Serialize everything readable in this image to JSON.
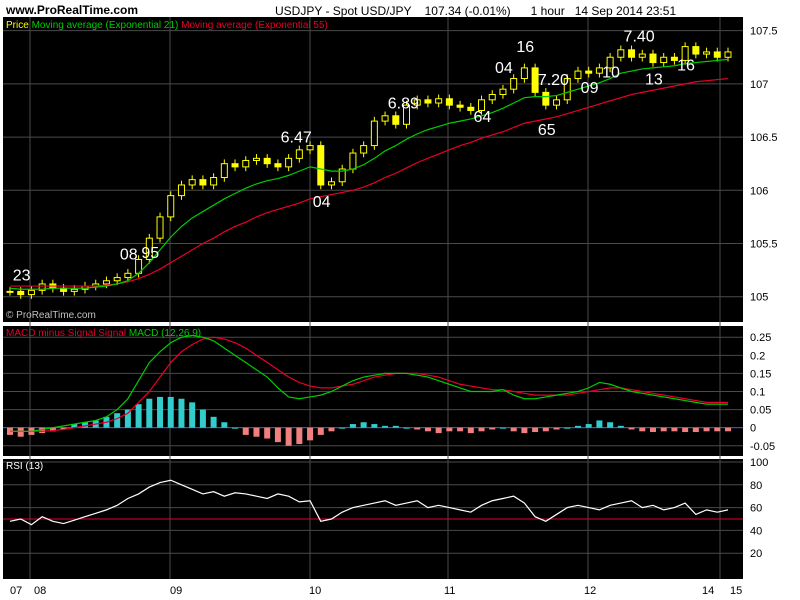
{
  "site": "www.ProRealTime.com",
  "title": "USDJPY - Spot USD/JPY    107.34 (-0.01%)      1 hour   14 Sep 2014 23:51",
  "watermark": "© ProRealTime.com",
  "chart_data": [
    {
      "type": "line",
      "name": "price",
      "legend": [
        "Price",
        "Moving average (Exponential 21)",
        "Moving average (Exponential 55)"
      ],
      "ylim": [
        104.8,
        107.6
      ],
      "yticks": [
        105,
        105.5,
        106,
        106.5,
        107,
        107.5
      ],
      "price": [
        105.05,
        105.02,
        105.06,
        105.12,
        105.08,
        105.05,
        105.07,
        105.1,
        105.12,
        105.15,
        105.18,
        105.22,
        105.35,
        105.55,
        105.75,
        105.95,
        106.05,
        106.1,
        106.05,
        106.12,
        106.25,
        106.22,
        106.28,
        106.3,
        106.25,
        106.22,
        106.3,
        106.38,
        106.42,
        106.05,
        106.08,
        106.2,
        106.35,
        106.42,
        106.65,
        106.7,
        106.62,
        106.8,
        106.85,
        106.82,
        106.86,
        106.8,
        106.78,
        106.75,
        106.85,
        106.9,
        106.95,
        107.05,
        107.15,
        106.92,
        106.8,
        106.85,
        107.05,
        107.12,
        107.1,
        107.15,
        107.25,
        107.32,
        107.25,
        107.28,
        107.2,
        107.25,
        107.22,
        107.35,
        107.28,
        107.3,
        107.25,
        107.3
      ],
      "ema21": [
        105.08,
        105.07,
        105.07,
        105.07,
        105.08,
        105.08,
        105.08,
        105.08,
        105.09,
        105.1,
        105.12,
        105.15,
        105.22,
        105.32,
        105.44,
        105.56,
        105.66,
        105.74,
        105.8,
        105.86,
        105.92,
        105.97,
        106.02,
        106.06,
        106.09,
        106.11,
        106.14,
        106.18,
        106.22,
        106.2,
        106.18,
        106.18,
        106.2,
        106.24,
        106.3,
        106.37,
        106.42,
        106.48,
        106.53,
        106.57,
        106.6,
        106.63,
        106.65,
        106.67,
        106.7,
        106.73,
        106.77,
        106.82,
        106.87,
        106.88,
        106.88,
        106.89,
        106.92,
        106.95,
        106.98,
        107.01,
        107.05,
        107.1,
        107.12,
        107.14,
        107.15,
        107.16,
        107.17,
        107.19,
        107.2,
        107.21,
        107.22,
        107.23
      ],
      "ema55": [
        105.1,
        105.1,
        105.1,
        105.1,
        105.1,
        105.1,
        105.1,
        105.1,
        105.1,
        105.11,
        105.12,
        105.14,
        105.17,
        105.21,
        105.26,
        105.32,
        105.38,
        105.44,
        105.5,
        105.55,
        105.61,
        105.66,
        105.7,
        105.75,
        105.79,
        105.82,
        105.85,
        105.88,
        105.92,
        105.94,
        105.96,
        105.98,
        106.0,
        106.03,
        106.07,
        106.12,
        106.16,
        106.21,
        106.26,
        106.3,
        106.34,
        106.38,
        106.42,
        106.45,
        106.49,
        106.52,
        106.55,
        106.59,
        106.63,
        106.65,
        106.67,
        106.69,
        106.72,
        106.75,
        106.78,
        106.81,
        106.84,
        106.87,
        106.9,
        106.92,
        106.94,
        106.96,
        106.98,
        107.0,
        107.02,
        107.03,
        107.04,
        107.05
      ],
      "annotations": [
        "23",
        "08",
        "95",
        "6.47",
        "04",
        "6.89",
        "64",
        "04",
        "16",
        "7.20",
        "65",
        "09",
        "7.40",
        "10",
        "13",
        "16"
      ]
    },
    {
      "type": "bar",
      "name": "macd",
      "legend": [
        "MACD minus Signal",
        "Signal",
        "MACD (12,26,9)"
      ],
      "ylim": [
        -0.07,
        0.27
      ],
      "yticks": [
        -0.05,
        0,
        0.05,
        0.1,
        0.15,
        0.2,
        0.25
      ],
      "macd": [
        -0.01,
        -0.01,
        -0.01,
        -0.005,
        0,
        0.005,
        0.01,
        0.015,
        0.02,
        0.03,
        0.05,
        0.08,
        0.13,
        0.18,
        0.21,
        0.235,
        0.25,
        0.255,
        0.25,
        0.24,
        0.22,
        0.2,
        0.18,
        0.16,
        0.14,
        0.11,
        0.085,
        0.08,
        0.085,
        0.09,
        0.1,
        0.115,
        0.13,
        0.14,
        0.145,
        0.15,
        0.15,
        0.15,
        0.145,
        0.14,
        0.13,
        0.12,
        0.11,
        0.1,
        0.1,
        0.1,
        0.105,
        0.09,
        0.08,
        0.08,
        0.085,
        0.09,
        0.095,
        0.1,
        0.11,
        0.125,
        0.12,
        0.11,
        0.1,
        0.095,
        0.09,
        0.085,
        0.08,
        0.075,
        0.07,
        0.065,
        0.065,
        0.065
      ],
      "signal": [
        -0.01,
        -0.01,
        -0.01,
        -0.01,
        -0.008,
        -0.005,
        0,
        0.005,
        0.01,
        0.015,
        0.025,
        0.04,
        0.07,
        0.1,
        0.14,
        0.18,
        0.21,
        0.23,
        0.245,
        0.25,
        0.245,
        0.235,
        0.22,
        0.2,
        0.18,
        0.16,
        0.14,
        0.125,
        0.115,
        0.11,
        0.11,
        0.115,
        0.12,
        0.13,
        0.14,
        0.145,
        0.15,
        0.15,
        0.15,
        0.145,
        0.14,
        0.13,
        0.12,
        0.115,
        0.11,
        0.105,
        0.105,
        0.1,
        0.095,
        0.09,
        0.09,
        0.09,
        0.09,
        0.095,
        0.1,
        0.105,
        0.11,
        0.11,
        0.105,
        0.1,
        0.095,
        0.09,
        0.085,
        0.08,
        0.075,
        0.07,
        0.07,
        0.07
      ],
      "hist": [
        -0.02,
        -0.025,
        -0.02,
        -0.015,
        -0.01,
        -0.005,
        0.01,
        0.015,
        0.02,
        0.03,
        0.04,
        0.05,
        0.065,
        0.08,
        0.085,
        0.085,
        0.08,
        0.07,
        0.05,
        0.03,
        0.015,
        0,
        -0.02,
        -0.025,
        -0.03,
        -0.04,
        -0.05,
        -0.045,
        -0.035,
        -0.02,
        -0.01,
        0,
        0.01,
        0.015,
        0.01,
        0.005,
        0.005,
        0,
        -0.005,
        -0.01,
        -0.015,
        -0.01,
        -0.01,
        -0.015,
        -0.01,
        -0.005,
        0,
        -0.01,
        -0.015,
        -0.012,
        -0.01,
        -0.005,
        0,
        0.005,
        0.01,
        0.02,
        0.015,
        0.005,
        -0.005,
        -0.01,
        -0.012,
        -0.01,
        -0.01,
        -0.012,
        -0.012,
        -0.01,
        -0.01,
        -0.01
      ]
    },
    {
      "type": "line",
      "name": "rsi",
      "legend": [
        "RSI (13)"
      ],
      "ylim": [
        0,
        100
      ],
      "yticks": [
        20,
        40,
        60,
        80,
        100
      ],
      "level": 50,
      "rsi": [
        48,
        50,
        45,
        52,
        48,
        46,
        49,
        52,
        55,
        58,
        62,
        68,
        72,
        78,
        82,
        84,
        80,
        76,
        72,
        74,
        70,
        73,
        72,
        70,
        68,
        72,
        70,
        65,
        66,
        48,
        50,
        56,
        60,
        62,
        64,
        66,
        62,
        64,
        66,
        60,
        62,
        60,
        58,
        56,
        62,
        66,
        68,
        70,
        64,
        52,
        48,
        54,
        60,
        62,
        60,
        58,
        62,
        64,
        66,
        60,
        62,
        58,
        60,
        64,
        54,
        58,
        56,
        58
      ],
      "x_labels": [
        "07",
        "08",
        "09",
        "10",
        "11",
        "12",
        "14",
        "15"
      ]
    }
  ],
  "colors": {
    "background": "#000000",
    "price": "#ffff00",
    "ema21": "#00cc00",
    "ema55": "#e8002a",
    "hist_pos": "#33cccc",
    "hist_neg": "#f08080",
    "rsi": "#ffffff",
    "grid": "#4a4a4a"
  }
}
